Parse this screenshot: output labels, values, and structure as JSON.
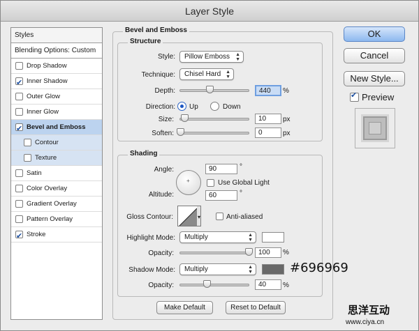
{
  "window": {
    "title": "Layer Style"
  },
  "styles_panel": {
    "header": "Styles",
    "blending_options": "Blending Options: Custom",
    "items": [
      {
        "label": "Drop Shadow",
        "checked": false
      },
      {
        "label": "Inner Shadow",
        "checked": true
      },
      {
        "label": "Outer Glow",
        "checked": false
      },
      {
        "label": "Inner Glow",
        "checked": false
      },
      {
        "label": "Bevel and Emboss",
        "checked": true,
        "selected": true
      },
      {
        "label": "Contour",
        "checked": false,
        "sub": true
      },
      {
        "label": "Texture",
        "checked": false,
        "sub": true
      },
      {
        "label": "Satin",
        "checked": false
      },
      {
        "label": "Color Overlay",
        "checked": false
      },
      {
        "label": "Gradient Overlay",
        "checked": false
      },
      {
        "label": "Pattern Overlay",
        "checked": false
      },
      {
        "label": "Stroke",
        "checked": true
      }
    ]
  },
  "bevel": {
    "section_title": "Bevel and Emboss",
    "structure": {
      "title": "Structure",
      "style_label": "Style:",
      "style_value": "Pillow Emboss",
      "technique_label": "Technique:",
      "technique_value": "Chisel Hard",
      "depth_label": "Depth:",
      "depth_value": "440",
      "depth_unit": "%",
      "direction_label": "Direction:",
      "direction_up": "Up",
      "direction_down": "Down",
      "direction_selected": "up",
      "size_label": "Size:",
      "size_value": "10",
      "size_unit": "px",
      "soften_label": "Soften:",
      "soften_value": "0",
      "soften_unit": "px"
    },
    "shading": {
      "title": "Shading",
      "angle_label": "Angle:",
      "angle_value": "90",
      "angle_unit": "°",
      "use_global_light": "Use Global Light",
      "use_global_light_checked": false,
      "altitude_label": "Altitude:",
      "altitude_value": "60",
      "altitude_unit": "°",
      "gloss_contour_label": "Gloss Contour:",
      "anti_aliased": "Anti-aliased",
      "anti_aliased_checked": false,
      "highlight_mode_label": "Highlight Mode:",
      "highlight_mode_value": "Multiply",
      "highlight_color": "#ffffff",
      "highlight_opacity_label": "Opacity:",
      "highlight_opacity_value": "100",
      "highlight_opacity_unit": "%",
      "shadow_mode_label": "Shadow Mode:",
      "shadow_mode_value": "Multiply",
      "shadow_color": "#696969",
      "shadow_color_annotation": "#696969",
      "shadow_opacity_label": "Opacity:",
      "shadow_opacity_value": "40",
      "shadow_opacity_unit": "%"
    },
    "make_default": "Make Default",
    "reset_to_default": "Reset to Default"
  },
  "buttons": {
    "ok": "OK",
    "cancel": "Cancel",
    "new_style": "New Style...",
    "preview": "Preview",
    "preview_checked": true
  },
  "watermark": {
    "chinese": "思洋互动",
    "url": "www.ciya.cn"
  }
}
